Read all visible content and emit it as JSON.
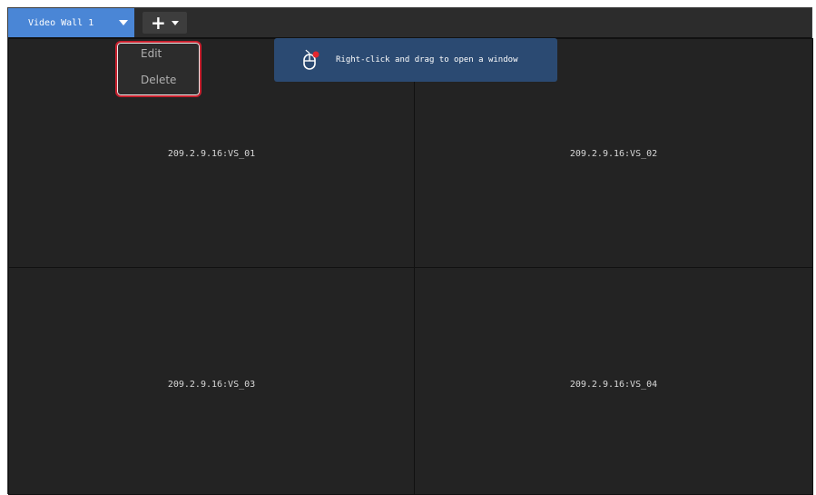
{
  "toolbar": {
    "tab_label": "Video Wall 1",
    "add_symbol": "+"
  },
  "context_menu": {
    "items": [
      {
        "label": "Edit"
      },
      {
        "label": "Delete"
      }
    ]
  },
  "tooltip": {
    "text": "Right-click and drag to open a window",
    "icon": "mouse-right-click-icon"
  },
  "grid": {
    "cells": [
      {
        "label": "209.2.9.16:VS_01"
      },
      {
        "label": "209.2.9.16:VS_02"
      },
      {
        "label": "209.2.9.16:VS_03"
      },
      {
        "label": "209.2.9.16:VS_04"
      }
    ]
  },
  "colors": {
    "tab_active": "#4a86d6",
    "tooltip_bg": "#2b4a72",
    "menu_highlight": "#c8202e",
    "cell_bg": "#232323"
  }
}
